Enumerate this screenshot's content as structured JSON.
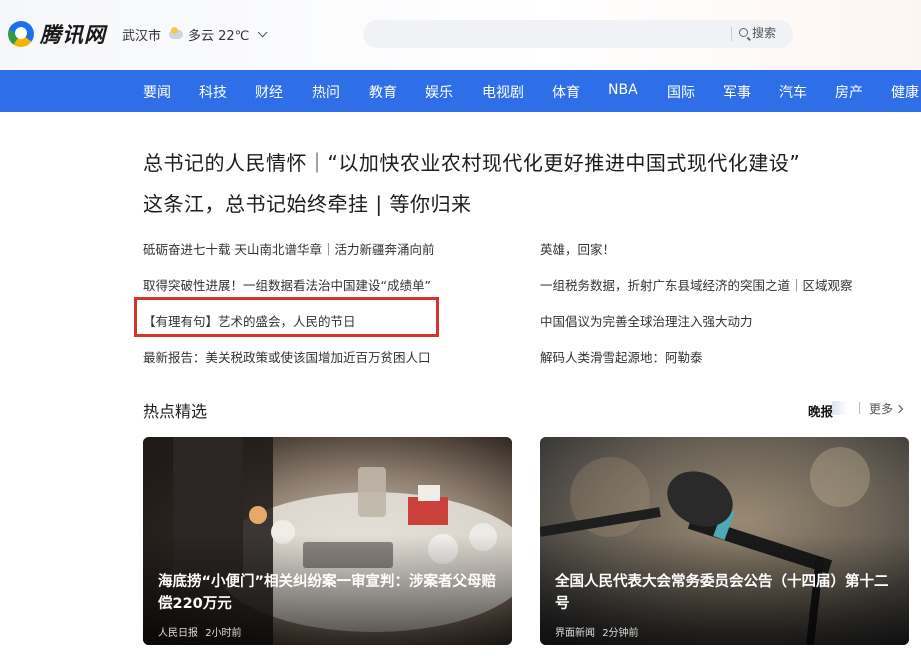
{
  "header": {
    "logo_text": "腾讯网",
    "location": "武汉市",
    "weather": "多云 22℃",
    "search_placeholder": "",
    "search_label": "搜索"
  },
  "nav": {
    "items": [
      "要闻",
      "科技",
      "财经",
      "热问",
      "教育",
      "娱乐",
      "电视剧",
      "体育",
      "NBA",
      "国际",
      "军事",
      "汽车",
      "房产",
      "健康"
    ]
  },
  "headlines": [
    "总书记的人民情怀｜“以加快农业农村现代化更好推进中国式现代化建设”",
    "这条江，总书记始终牵挂 | 等你归来"
  ],
  "news_left": [
    "砥砺奋进七十载 天山南北谱华章｜活力新疆奔涌向前",
    "取得突破性进展！一组数据看法治中国建设“成绩单”",
    "【有理有句】艺术的盛会，人民的节日",
    "最新报告：美关税政策或使该国增加近百万贫困人口"
  ],
  "news_right": [
    "英雄，回家！",
    "一组税务数据，折射广东县域经济的突围之道｜区域观察",
    "中国倡议为完善全球治理注入强大动力",
    "解码人类滑雪起源地：阿勒泰"
  ],
  "section": {
    "title": "热点精选",
    "wanbao": "晚报",
    "more": "更多"
  },
  "cards": [
    {
      "title": "海底捞“小便门”相关纠纷案一审宣判：涉案者父母赔偿220万元",
      "source": "人民日报",
      "time": "2小时前"
    },
    {
      "title": "全国人民代表大会常务委员会公告（十四届）第十二号",
      "source": "界面新闻",
      "time": "2分钟前"
    }
  ],
  "colors": {
    "nav_bg": "#2e6fe8",
    "highlight_border": "#d5332c"
  }
}
